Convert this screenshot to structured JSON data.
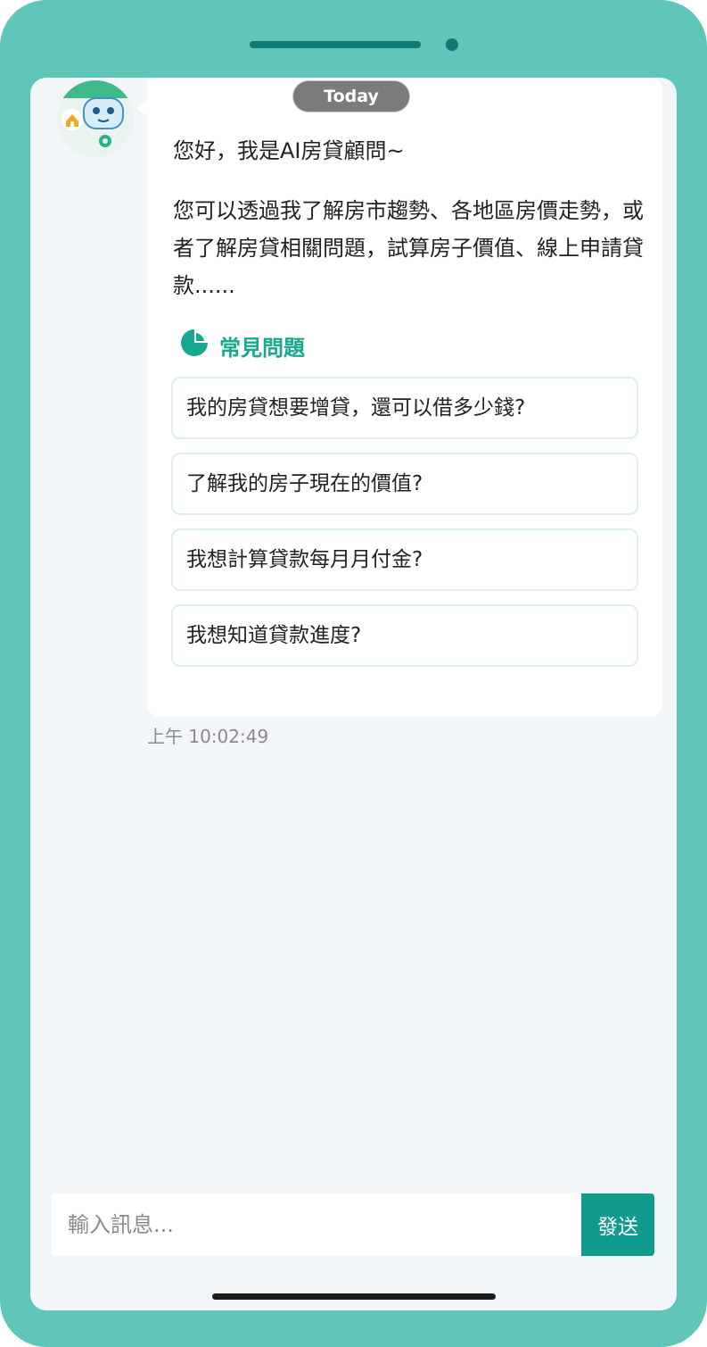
{
  "chat": {
    "date_label": "Today",
    "greeting": "您好，我是AI房貸顧問~",
    "intro": "您可以透過我了解房市趨勢、各地區房價走勢，或者了解房貸相關問題，試算房子價值、線上申請貸款......",
    "faq_title": "常見問題",
    "faq_icon": "pie-chart-icon",
    "faq_items": [
      {
        "label": "我的房貸想要增貸，還可以借多少錢?"
      },
      {
        "label": "了解我的房子現在的價值?"
      },
      {
        "label": "我想計算貸款每月月付金?"
      },
      {
        "label": "我想知道貸款進度?"
      }
    ],
    "timestamp": "上午 10:02:49"
  },
  "composer": {
    "placeholder": "輸入訊息...",
    "send_label": "發送"
  },
  "colors": {
    "frame": "#5fc6b9",
    "accent": "#17a98f",
    "send_button": "#0f9b8e",
    "screen_bg": "#f3f6f9"
  }
}
